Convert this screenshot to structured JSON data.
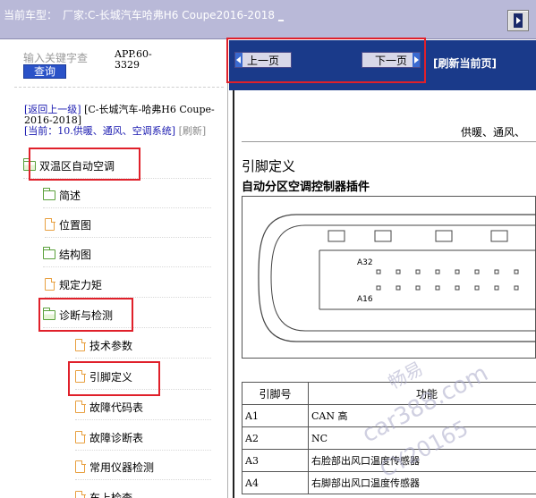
{
  "topbar": {
    "prefix": "当前车型：",
    "vehicle": "厂家:C-长城汽车哈弗H6 Coupe2016-2018",
    "link_marker": "_"
  },
  "sidebar": {
    "search_placeholder": "输入关键字查",
    "search_button": "查询",
    "app_code": "APP.60-3329",
    "crumb_back": "[返回上一级]",
    "crumb_vehicle": "[C-长城汽车-哈弗H6 Coupe-2016-2018]",
    "crumb_current": "[当前：10.供暖、通风、空调系统]",
    "crumb_refresh": "[刷新]",
    "tree": [
      {
        "label": "双温区自动空调",
        "icon": "folder-open-icon"
      },
      {
        "label": "简述",
        "icon": "folder-icon"
      },
      {
        "label": "位置图",
        "icon": "document-icon"
      },
      {
        "label": "结构图",
        "icon": "folder-icon"
      },
      {
        "label": "规定力矩",
        "icon": "document-icon"
      },
      {
        "label": "诊断与检测",
        "icon": "folder-open-icon"
      },
      {
        "label": "技术参数",
        "icon": "document-icon"
      },
      {
        "label": "引脚定义",
        "icon": "document-icon"
      },
      {
        "label": "故障代码表",
        "icon": "document-icon"
      },
      {
        "label": "故障诊断表",
        "icon": "document-icon"
      },
      {
        "label": "常用仪器检测",
        "icon": "document-icon"
      },
      {
        "label": "车上检查",
        "icon": "document-icon"
      }
    ]
  },
  "nav": {
    "prev": "上一页",
    "next": "下一页",
    "refresh": "[刷新当前页]"
  },
  "document": {
    "header": "供暖、通风、",
    "title": "引脚定义",
    "subtitle": "自动分区空调控制器插件",
    "pin_top": "A32",
    "pin_bottom": "A16",
    "table_headers": [
      "引脚号",
      "功能"
    ],
    "rows": [
      {
        "pin": "A1",
        "func": "CAN 高"
      },
      {
        "pin": "A2",
        "func": "NC"
      },
      {
        "pin": "A3",
        "func": "右脸部出风口温度传感器"
      },
      {
        "pin": "A4",
        "func": "右脚部出风口温度传感器"
      }
    ]
  },
  "watermark": {
    "line1": "畅易",
    "line2": "car388.com",
    "line3": "CY20165"
  },
  "colors": {
    "topbar": "#b9b9d8",
    "navbar": "#1a3a8a",
    "highlight": "#e0202a",
    "link_blue": "#1a1ab0"
  }
}
